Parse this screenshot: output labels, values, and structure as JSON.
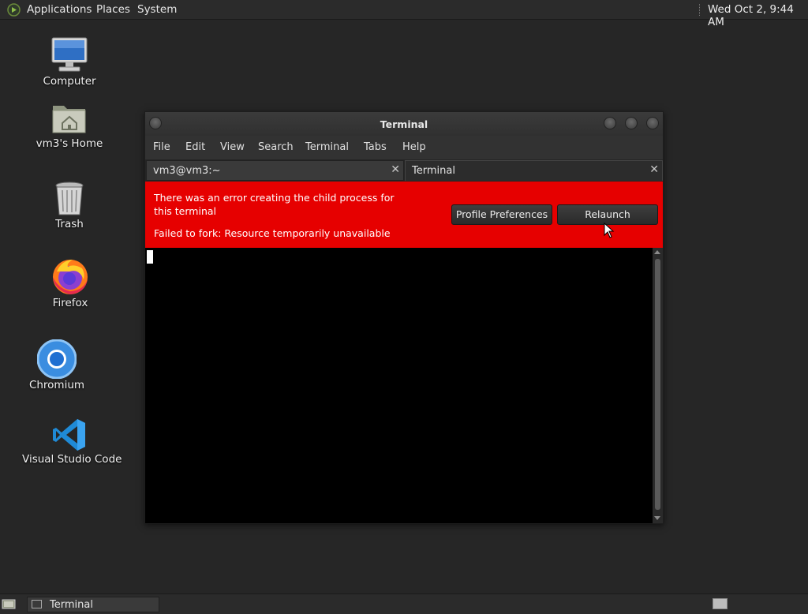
{
  "top_panel": {
    "menus": [
      "Applications",
      "Places",
      "System"
    ],
    "clock": "Wed Oct  2,  9:44 AM"
  },
  "desktop_icons": [
    {
      "label": "Computer",
      "icon": "computer-icon"
    },
    {
      "label": "vm3's Home",
      "icon": "home-folder-icon"
    },
    {
      "label": "Trash",
      "icon": "trash-icon"
    },
    {
      "label": "Firefox",
      "icon": "firefox-icon"
    },
    {
      "label": "Chromium",
      "icon": "chromium-icon"
    },
    {
      "label": "Visual Studio Code",
      "icon": "vscode-icon"
    }
  ],
  "window": {
    "title": "Terminal",
    "menu": [
      "File",
      "Edit",
      "View",
      "Search",
      "Terminal",
      "Tabs",
      "Help"
    ],
    "tabs": [
      {
        "label": "vm3@vm3:~",
        "active": false
      },
      {
        "label": "Terminal",
        "active": true
      }
    ],
    "error": {
      "message": "There was an error creating the child process for this terminal",
      "detail": "Failed to fork: Resource temporarily unavailable",
      "buttons": [
        "Profile Preferences",
        "Relaunch"
      ],
      "color": "#e60000"
    }
  },
  "taskbar": {
    "tasks": [
      {
        "label": "Terminal",
        "icon": "terminal-icon"
      }
    ]
  }
}
